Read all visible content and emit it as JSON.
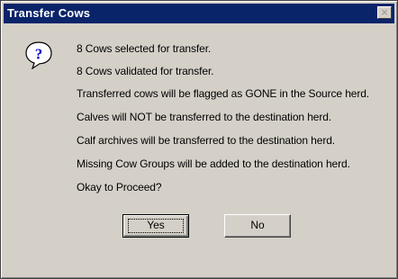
{
  "window": {
    "title": "Transfer Cows",
    "close_glyph": "×"
  },
  "icon": "question-icon",
  "messages": [
    "8 Cows selected for transfer.",
    "8 Cows validated for transfer.",
    "Transferred cows will be flagged as GONE in the Source herd.",
    "Calves will NOT be transferred to the destination herd.",
    "Calf archives will be transferred to the destination herd.",
    "Missing Cow Groups will be added to the destination herd.",
    "Okay to Proceed?"
  ],
  "buttons": {
    "yes_label": "Yes",
    "no_label": "No"
  }
}
